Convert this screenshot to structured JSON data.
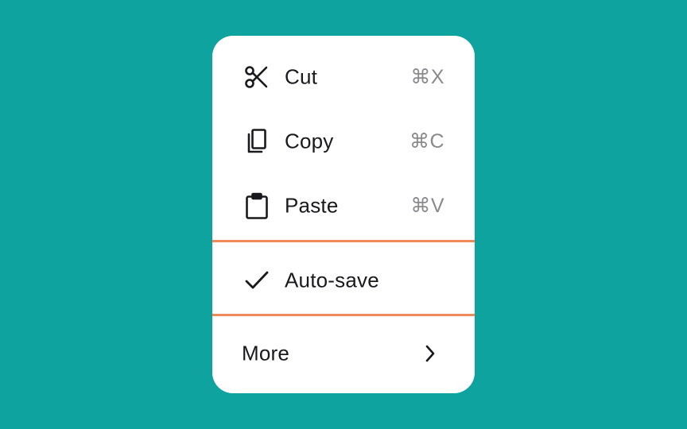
{
  "menu": {
    "items": [
      {
        "label": "Cut",
        "shortcut": "⌘X",
        "icon": "scissors-icon"
      },
      {
        "label": "Copy",
        "shortcut": "⌘C",
        "icon": "copy-icon"
      },
      {
        "label": "Paste",
        "shortcut": "⌘V",
        "icon": "clipboard-icon"
      }
    ],
    "toggle": {
      "label": "Auto-save",
      "icon": "checkmark-icon",
      "checked": true
    },
    "more": {
      "label": "More",
      "icon": "chevron-right-icon"
    }
  },
  "colors": {
    "background": "#0fa39f",
    "menu_background": "#ffffff",
    "divider": "#f08a5a",
    "text": "#1a1a1e",
    "shortcut_text": "#8a8a8e"
  }
}
